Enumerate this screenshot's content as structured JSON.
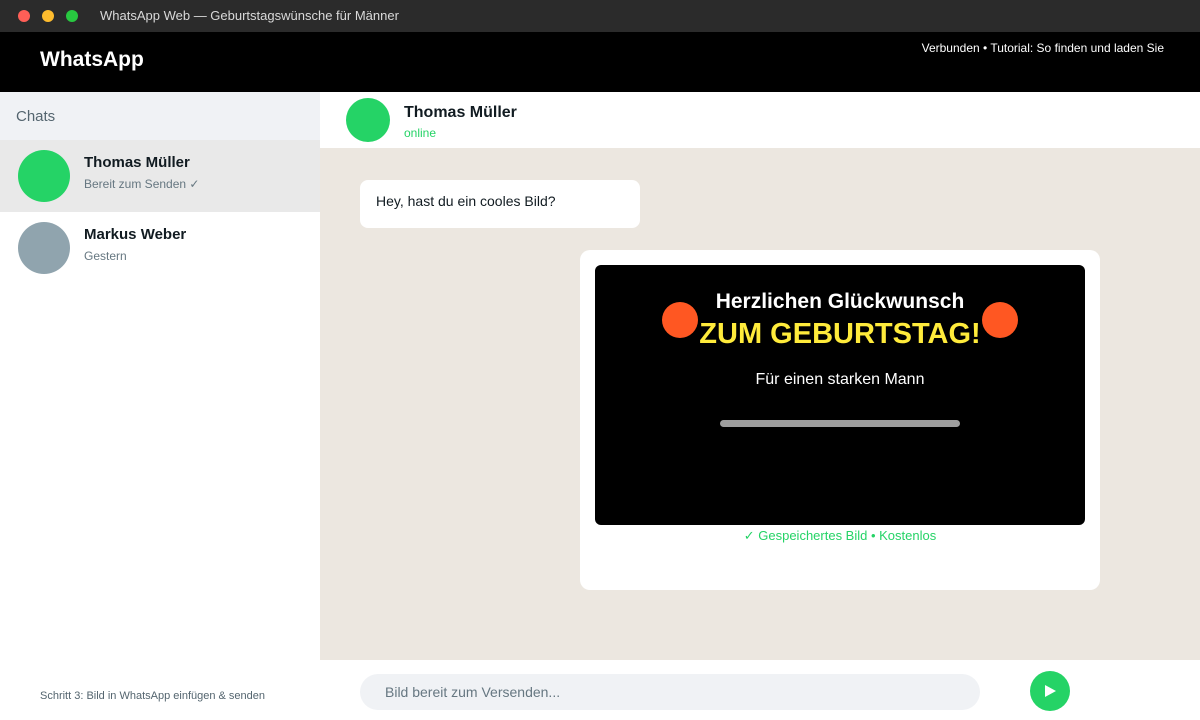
{
  "window": {
    "title": "WhatsApp Web — Geburtstagswünsche für Männer"
  },
  "header": {
    "brand": "WhatsApp",
    "status": "Verbunden • Tutorial: So finden und laden Sie"
  },
  "sidebar": {
    "title": "Chats",
    "items": [
      {
        "name": "Thomas Müller",
        "subtitle": "Bereit zum Senden ✓",
        "avatar_color": "#25d366",
        "active": true
      },
      {
        "name": "Markus Weber",
        "subtitle": "Gestern",
        "avatar_color": "#90a4ae",
        "active": false
      }
    ],
    "step_hint": "Schritt 3: Bild in WhatsApp einfügen & senden"
  },
  "conversation": {
    "contact_name": "Thomas Müller",
    "contact_status": "online",
    "incoming_message": "Hey, hast du ein cooles Bild?",
    "image_card": {
      "line1": "Herzlichen Glückwunsch",
      "line2": "ZUM GEBURTSTAG!",
      "line3": "Für einen starken Mann",
      "saved_note": "✓ Gespeichertes Bild • Kostenlos"
    }
  },
  "composer": {
    "placeholder": "Bild bereit zum Versenden...",
    "send_icon": "send-icon"
  },
  "colors": {
    "accent": "#25d366",
    "balloon": "#ff5722",
    "headline_yellow": "#ffeb3b",
    "chat_background": "#ece7e0"
  }
}
